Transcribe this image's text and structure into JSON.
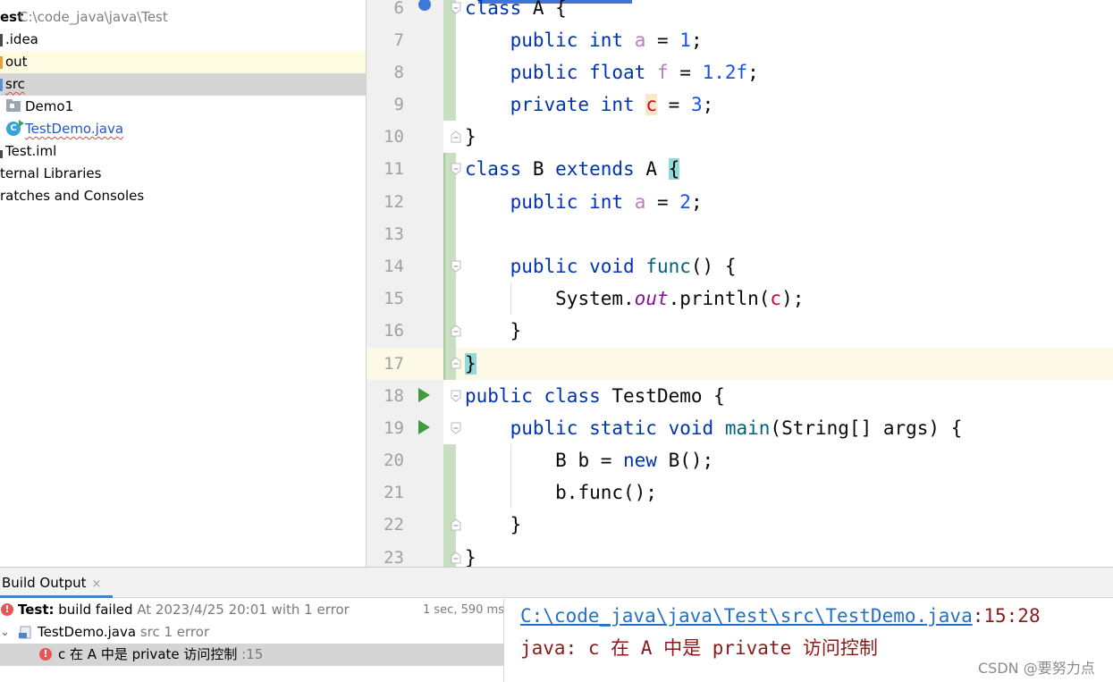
{
  "project_tree": {
    "root_label": "est",
    "root_path": "C:\\code_java\\java\\Test",
    "items": [
      {
        "label": ".idea"
      },
      {
        "label": "out"
      },
      {
        "label": "src"
      },
      {
        "label": "Demo1"
      },
      {
        "label": "TestDemo.java"
      },
      {
        "label": "Test.iml"
      },
      {
        "label": "ternal Libraries"
      },
      {
        "label": "ratches and Consoles"
      }
    ]
  },
  "editor": {
    "line_numbers": [
      "6",
      "7",
      "8",
      "9",
      "10",
      "11",
      "12",
      "13",
      "14",
      "15",
      "16",
      "17",
      "18",
      "19",
      "20",
      "21",
      "22",
      "23"
    ],
    "current_line": "17",
    "code": {
      "l6": {
        "kw1": "class",
        "rest": " A {"
      },
      "l7": {
        "kw1": "public",
        "kw2": "int",
        "name": "a",
        "eq": " = ",
        "num": "1",
        "end": ";"
      },
      "l8": {
        "kw1": "public",
        "kw2": "float",
        "name": "f",
        "eq": " = ",
        "num": "1.2f",
        "end": ";"
      },
      "l9": {
        "kw1": "private",
        "kw2": "int",
        "name": "c",
        "eq": " = ",
        "num": "3",
        "end": ";"
      },
      "l10": {
        "text": "}"
      },
      "l11": {
        "kw1": "class",
        "cls": " B ",
        "kw2": "extends",
        "rest": " A ",
        "brace": "{"
      },
      "l12": {
        "kw1": "public",
        "kw2": "int",
        "name": "a",
        "eq": " = ",
        "num": "2",
        "end": ";"
      },
      "l14": {
        "kw1": "public",
        "kw2": "void",
        "fn": "func",
        "rest": "() {"
      },
      "l15": {
        "pre": "System.",
        "field": "out",
        "mid": ".println(",
        "arg": "c",
        "end": ");"
      },
      "l16": {
        "text": "}"
      },
      "l17": {
        "text": "}"
      },
      "l18": {
        "kw1": "public",
        "kw2": "class",
        "rest": " TestDemo {"
      },
      "l19": {
        "kw1": "public",
        "kw2": "static",
        "kw3": "void",
        "fn": "main",
        "rest": "(String[] args) {"
      },
      "l20": {
        "pre": "B b = ",
        "kw": "new",
        "rest": " B();"
      },
      "l21": {
        "text": "b.func();"
      },
      "l22": {
        "text": "}"
      },
      "l23": {
        "text": "}"
      }
    }
  },
  "build": {
    "tab_label": "Build Output",
    "close_glyph": "×",
    "summary_bold": "Test:",
    "summary_text": " build failed",
    "summary_time": " At 2023/4/25 20:01 with 1 error",
    "duration": "1 sec, 590 ms",
    "file_name": "TestDemo.java",
    "file_meta": " src 1 error",
    "error_text": "c 在 A 中是 private 访问控制",
    "error_line": " :15",
    "console_path": "C:\\code_java\\java\\Test\\src\\TestDemo.java",
    "console_pos": ":15:28",
    "console_message": "java: c 在 A 中是 private 访问控制"
  },
  "watermark": "CSDN @要努力点"
}
